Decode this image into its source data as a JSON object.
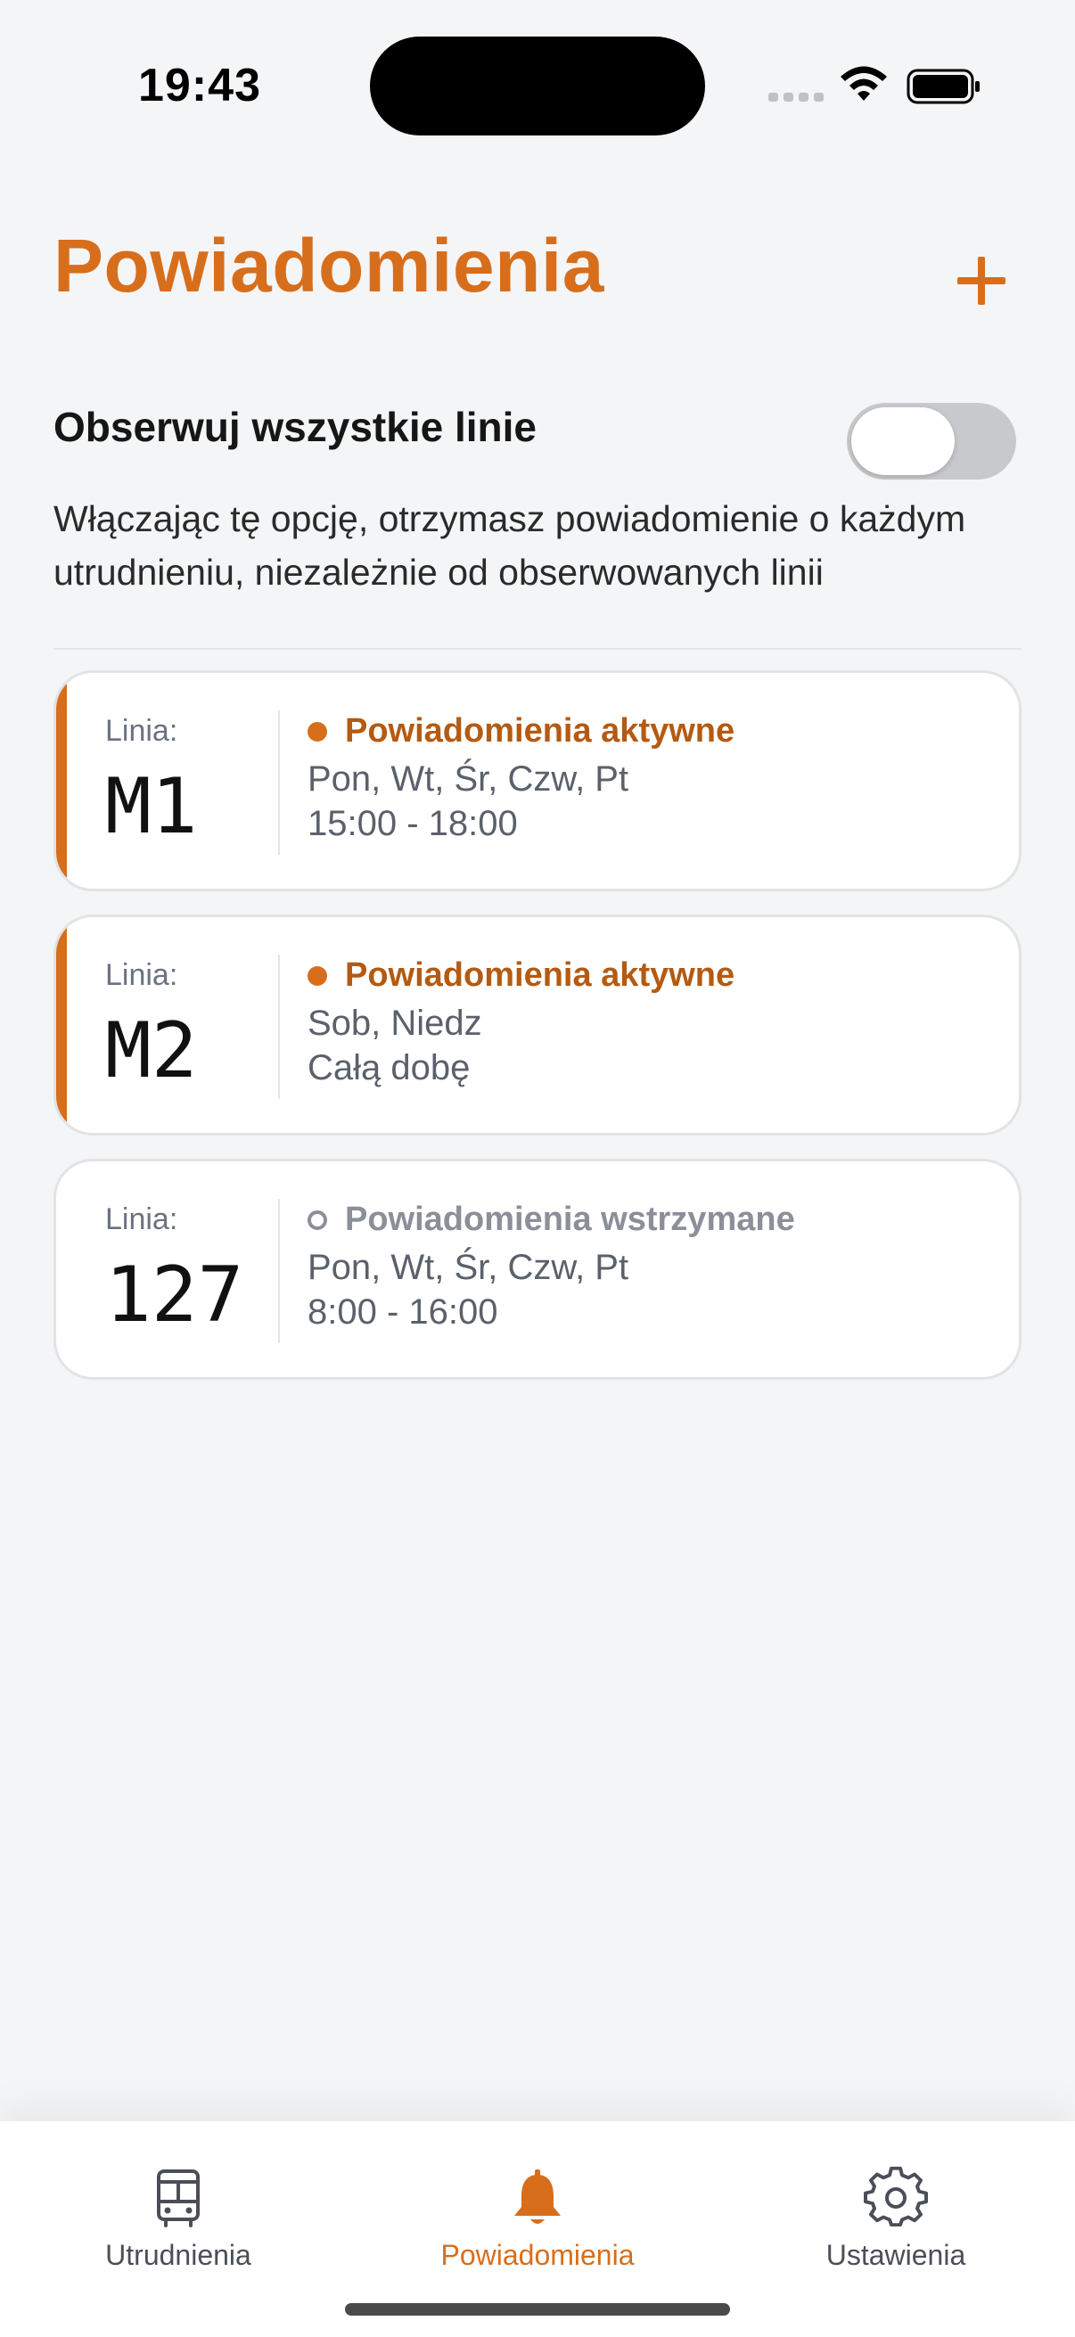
{
  "status_bar": {
    "time": "19:43"
  },
  "header": {
    "title": "Powiadomienia",
    "add_icon": "plus-icon"
  },
  "observe_all": {
    "label": "Obserwuj wszystkie linie",
    "enabled": false,
    "description": "Włączając tę opcję, otrzymasz powiadomienie o każdym utrudnieniu, niezależnie od obserwowanych linii"
  },
  "subscriptions": [
    {
      "line_label": "Linia:",
      "line": "M1",
      "status": "Powiadomienia aktywne",
      "active": true,
      "days": "Pon, Wt, Śr, Czw, Pt",
      "hours": "15:00 - 18:00"
    },
    {
      "line_label": "Linia:",
      "line": "M2",
      "status": "Powiadomienia aktywne",
      "active": true,
      "days": "Sob, Niedz",
      "hours": "Całą dobę"
    },
    {
      "line_label": "Linia:",
      "line": "127",
      "status": "Powiadomienia wstrzymane",
      "active": false,
      "days": "Pon, Wt, Śr, Czw, Pt",
      "hours": "8:00 - 16:00"
    }
  ],
  "tab_bar": {
    "tabs": [
      {
        "label": "Utrudnienia",
        "icon": "bus-icon",
        "selected": false
      },
      {
        "label": "Powiadomienia",
        "icon": "bell-icon",
        "selected": true
      },
      {
        "label": "Ustawienia",
        "icon": "gear-icon",
        "selected": false
      }
    ]
  },
  "colors": {
    "accent": "#d76e1c",
    "active_status": "#b45a12",
    "paused_status": "#8a8f98",
    "background": "#f4f5f7"
  }
}
